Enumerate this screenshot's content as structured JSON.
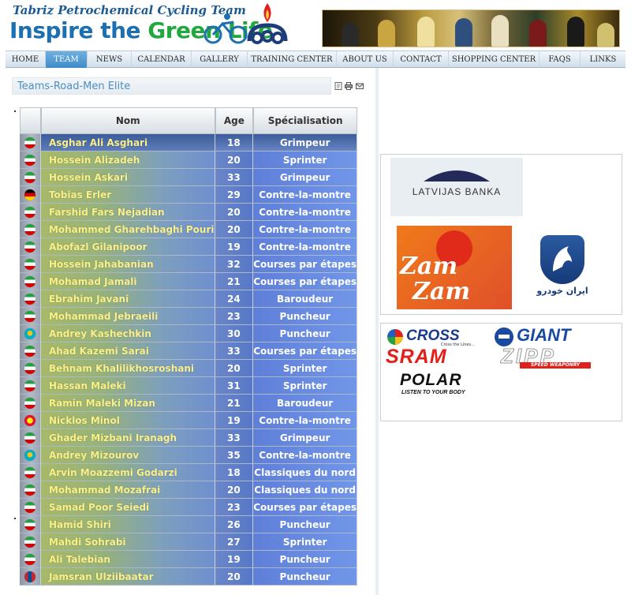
{
  "header": {
    "subtitle": "Tabriz Petrochemical Cycling Team",
    "tagline_part1": "Inspire the ",
    "tagline_part2": "Green Life"
  },
  "nav": {
    "items": [
      "HOME",
      "TEAM",
      "NEWS",
      "CALENDAR",
      "GALLERY",
      "TRAINING CENTER",
      "ABOUT US",
      "CONTACT",
      "SHOPPING CENTER",
      "FAQS",
      "LINKS"
    ],
    "active": "TEAM"
  },
  "page": {
    "title": "Teams-Road-Men Elite"
  },
  "table": {
    "headers": [
      "",
      "Nom",
      "Age",
      "Spécialisation"
    ],
    "rows": [
      {
        "flag": "iran",
        "name": "Asghar Ali Asghari",
        "age": "18",
        "spec": "Grimpeur"
      },
      {
        "flag": "iran",
        "name": "Hossein Alizadeh",
        "age": "20",
        "spec": "Sprinter"
      },
      {
        "flag": "iran",
        "name": "Hossein Askari",
        "age": "33",
        "spec": "Grimpeur"
      },
      {
        "flag": "germany",
        "name": "Tobias Erler",
        "age": "29",
        "spec": "Contre-la-montre"
      },
      {
        "flag": "iran",
        "name": "Farshid Fars Nejadian",
        "age": "20",
        "spec": "Contre-la-montre"
      },
      {
        "flag": "iran",
        "name": "Mohammed Gharehbaghi Pouri",
        "age": "20",
        "spec": "Contre-la-montre"
      },
      {
        "flag": "iran",
        "name": "Abofazl Gilanipoor",
        "age": "19",
        "spec": "Contre-la-montre"
      },
      {
        "flag": "iran",
        "name": "Hossein Jahabanian",
        "age": "32",
        "spec": "Courses par étapes"
      },
      {
        "flag": "iran",
        "name": "Mohamad Jamali",
        "age": "21",
        "spec": "Courses par étapes"
      },
      {
        "flag": "iran",
        "name": "Ebrahim Javani",
        "age": "24",
        "spec": "Baroudeur"
      },
      {
        "flag": "iran",
        "name": "Mohammad Jebraeili",
        "age": "23",
        "spec": "Puncheur"
      },
      {
        "flag": "kazakhstan",
        "name": "Andrey Kashechkin",
        "age": "30",
        "spec": "Puncheur"
      },
      {
        "flag": "iran",
        "name": "Ahad Kazemi Sarai",
        "age": "33",
        "spec": "Courses par étapes"
      },
      {
        "flag": "iran",
        "name": "Behnam Khalilikhosroshani",
        "age": "20",
        "spec": "Sprinter"
      },
      {
        "flag": "iran",
        "name": "Hassan Maleki",
        "age": "31",
        "spec": "Sprinter"
      },
      {
        "flag": "iran",
        "name": "Ramin Maleki Mizan",
        "age": "21",
        "spec": "Baroudeur"
      },
      {
        "flag": "kyrgyzstan",
        "name": "Nicklos Minol",
        "age": "19",
        "spec": "Contre-la-montre"
      },
      {
        "flag": "iran",
        "name": "Ghader Mizbani Iranagh",
        "age": "33",
        "spec": "Grimpeur"
      },
      {
        "flag": "kazakhstan",
        "name": "Andrey Mizourov",
        "age": "35",
        "spec": "Contre-la-montre"
      },
      {
        "flag": "iran",
        "name": "Arvin Moazzemi Godarzi",
        "age": "18",
        "spec": "Classiques du nord"
      },
      {
        "flag": "iran",
        "name": "Mohammad Mozafrai",
        "age": "20",
        "spec": "Classiques du nord"
      },
      {
        "flag": "iran",
        "name": "Samad Poor Seiedi",
        "age": "23",
        "spec": "Courses par étapes"
      },
      {
        "flag": "iran",
        "name": "Hamid Shiri",
        "age": "26",
        "spec": "Puncheur"
      },
      {
        "flag": "iran",
        "name": "Mahdi Sohrabi",
        "age": "27",
        "spec": "Sprinter"
      },
      {
        "flag": "iran",
        "name": "Ali Talebian",
        "age": "19",
        "spec": "Puncheur"
      },
      {
        "flag": "mongolia",
        "name": "Jamsran Ulziibaatar",
        "age": "20",
        "spec": "Puncheur"
      }
    ]
  },
  "sponsors": {
    "latvijas": "LATVIJAS BANKA",
    "zamzam_1": "Zam",
    "zamzam_2": "Zam",
    "iran_khodro": "ایران خودرو",
    "cross": "CROSS",
    "cross_tag": "Cross the Lines...",
    "giant": "GIANT",
    "sram": "SRAM",
    "zipp": "ZIPP",
    "zipp_tag": "SPEED WEAPONRY",
    "polar": "POLAR",
    "polar_tag": "LISTEN TO YOUR BODY"
  },
  "colors": {
    "brand_blue": "#1c6fb0",
    "brand_green": "#21a83f",
    "nav_active": "#3e8cc8",
    "title_text": "#4a8ec6",
    "name_text": "#fbf08a",
    "flags": {
      "iran": [
        "#239f40",
        "#ffffff",
        "#da0000"
      ],
      "germany": [
        "#000000",
        "#dd0000",
        "#ffce00"
      ],
      "kazakhstan": [
        "#00afca",
        "#00afca",
        "#fec50c"
      ],
      "kyrgyzstan": [
        "#e8112d",
        "#e8112d",
        "#ffef00"
      ],
      "mongolia": [
        "#c4272f",
        "#015197",
        "#c4272f"
      ]
    }
  }
}
